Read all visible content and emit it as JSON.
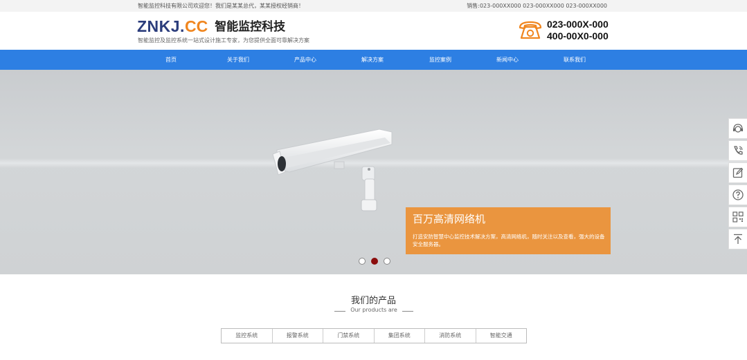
{
  "topbar": {
    "welcome": "智能监控科技有限公司欢迎您！我们是某某总代，某某授权经销商！",
    "sales": "销售:023-000XX000 023-000XX000 023-000XX000"
  },
  "header": {
    "logo_main": "ZNKJ.",
    "logo_accent": "CC",
    "logo_cn": "智能监控科技",
    "slogan": "智能监控及监控系统一站式设计施工专家，为您提供全面可靠解决方案",
    "phone_icon": "telephone-icon",
    "phones": [
      "023-000X-000",
      "400-00X0-000"
    ]
  },
  "nav": {
    "items": [
      "首页",
      "关于我们",
      "产品中心",
      "解决方案",
      "监控案例",
      "新闻中心",
      "联系我们"
    ]
  },
  "banner": {
    "caption_title": "百万高清网络机",
    "caption_text": "打造安防智慧中心监控技术解决方案，高清网络机，随时关注以及查看，强大的设备安全服务器。",
    "slides_count": 3,
    "active_slide": 2
  },
  "sidebar": {
    "icons": [
      "customer-service-icon",
      "phone-call-icon",
      "edit-icon",
      "help-icon",
      "qrcode-icon",
      "back-to-top-icon"
    ]
  },
  "products": {
    "title": "我们的产品",
    "subtitle": "Our products are",
    "tabs": [
      "监控系统",
      "报警系统",
      "门禁系统",
      "集团系统",
      "消防系统",
      "智能交通"
    ]
  },
  "colors": {
    "nav_bg": "#2d7fe3",
    "logo_blue": "#2b3d7c",
    "logo_orange": "#f0861f",
    "caption_bg": "#eb9137",
    "active_dot": "#8b0d0d"
  }
}
